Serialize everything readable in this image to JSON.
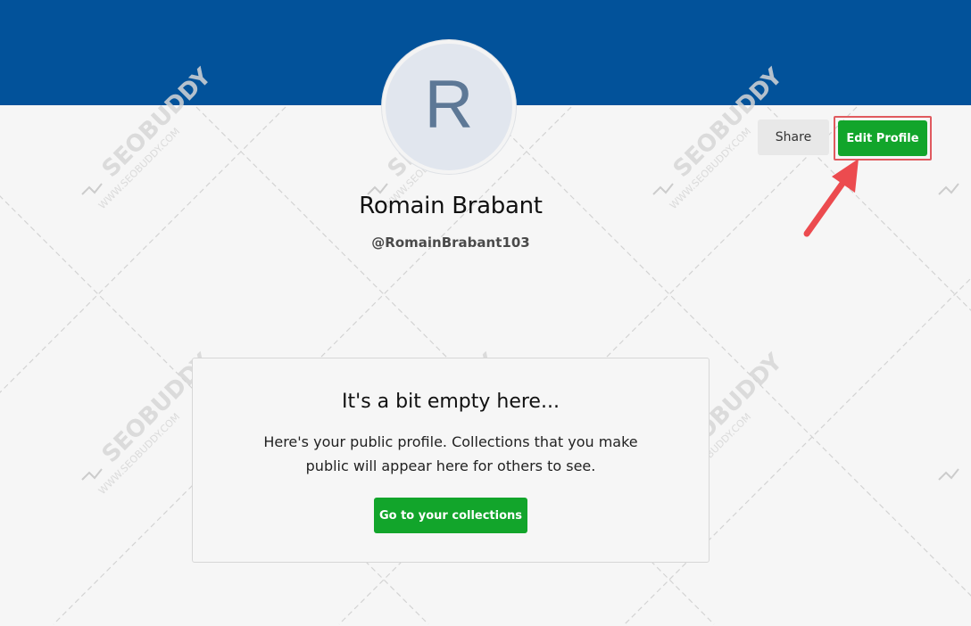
{
  "profile": {
    "avatar_initial": "R",
    "name": "Romain Brabant",
    "handle": "@RomainBrabant103"
  },
  "actions": {
    "share_label": "Share",
    "edit_label": "Edit Profile"
  },
  "empty_state": {
    "title": "It's a bit empty here...",
    "message_line1": "Here's your public profile. Collections that you make",
    "message_line2": "public will appear here for others to see.",
    "button_label": "Go to your collections"
  },
  "watermark": {
    "brand": "SEOBUDDY",
    "url": "WWW.SEOBUDDY.COM"
  },
  "colors": {
    "banner": "#02529a",
    "primary_button": "#12a52b",
    "highlight": "#e05a5f",
    "background": "#f6f6f6"
  }
}
